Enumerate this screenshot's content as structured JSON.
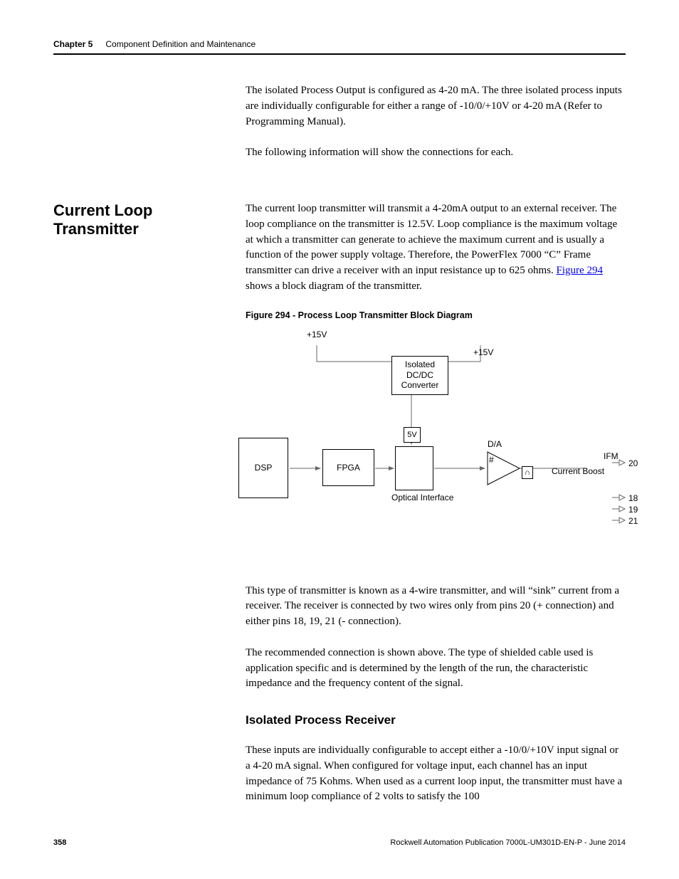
{
  "header": {
    "chapter": "Chapter 5",
    "subtitle": "Component Definition and Maintenance"
  },
  "intro": {
    "p1": "The isolated Process Output is configured as 4-20 mA. The three isolated process inputs are individually configurable for either a range of -10/0/+10V or 4-20 mA (Refer to Programming Manual).",
    "p2": "The following information will show the connections for each."
  },
  "section1": {
    "heading": "Current Loop Transmitter",
    "p1a": "The current loop transmitter will transmit a 4-20mA output to an external receiver. The loop compliance on the transmitter is 12.5V. Loop compliance is the maximum voltage at which a transmitter can generate to achieve the maximum current and is usually a function of the power supply voltage. Therefore, the PowerFlex 7000 “C” Frame transmitter can drive a receiver with an input resistance up to 625 ohms. ",
    "link": "Figure 294",
    "p1b": " shows a block diagram of the transmitter.",
    "figcaption": "Figure 294 - Process Loop Transmitter Block Diagram"
  },
  "diagram": {
    "plus15v_left": "+15V",
    "plus15v_right": "+15V",
    "dcdc": "Isolated DC/DC Converter",
    "five_v": "5V",
    "dsp": "DSP",
    "fpga": "FPGA",
    "optical": "Optical Interface",
    "da": "D/A",
    "ifm": "IFM",
    "current_boost": "Current Boost",
    "sharp": "#",
    "cap": "∩",
    "pin20": "20",
    "pin18": "18",
    "pin19": "19",
    "pin21": "21"
  },
  "after_diagram": {
    "p1": "This type of transmitter is known as a 4-wire transmitter, and will “sink” current from a receiver. The receiver is connected by two wires only from pins 20 (+ connection) and either pins 18, 19, 21 (- connection).",
    "p2": "The recommended connection is shown above. The type of shielded cable used is application specific and is determined by the length of the run, the characteristic impedance and the frequency content of the signal."
  },
  "section2": {
    "heading": "Isolated Process Receiver",
    "p1": "These inputs are individually configurable to accept either a -10/0/+10V input signal or a 4-20 mA signal. When configured for voltage input, each channel has an input impedance of 75 Kohms. When used as a current loop input, the transmitter must have a minimum loop compliance of 2 volts to satisfy the 100"
  },
  "footer": {
    "page": "358",
    "pub": "Rockwell Automation Publication 7000L-UM301D-EN-P - June 2014"
  }
}
